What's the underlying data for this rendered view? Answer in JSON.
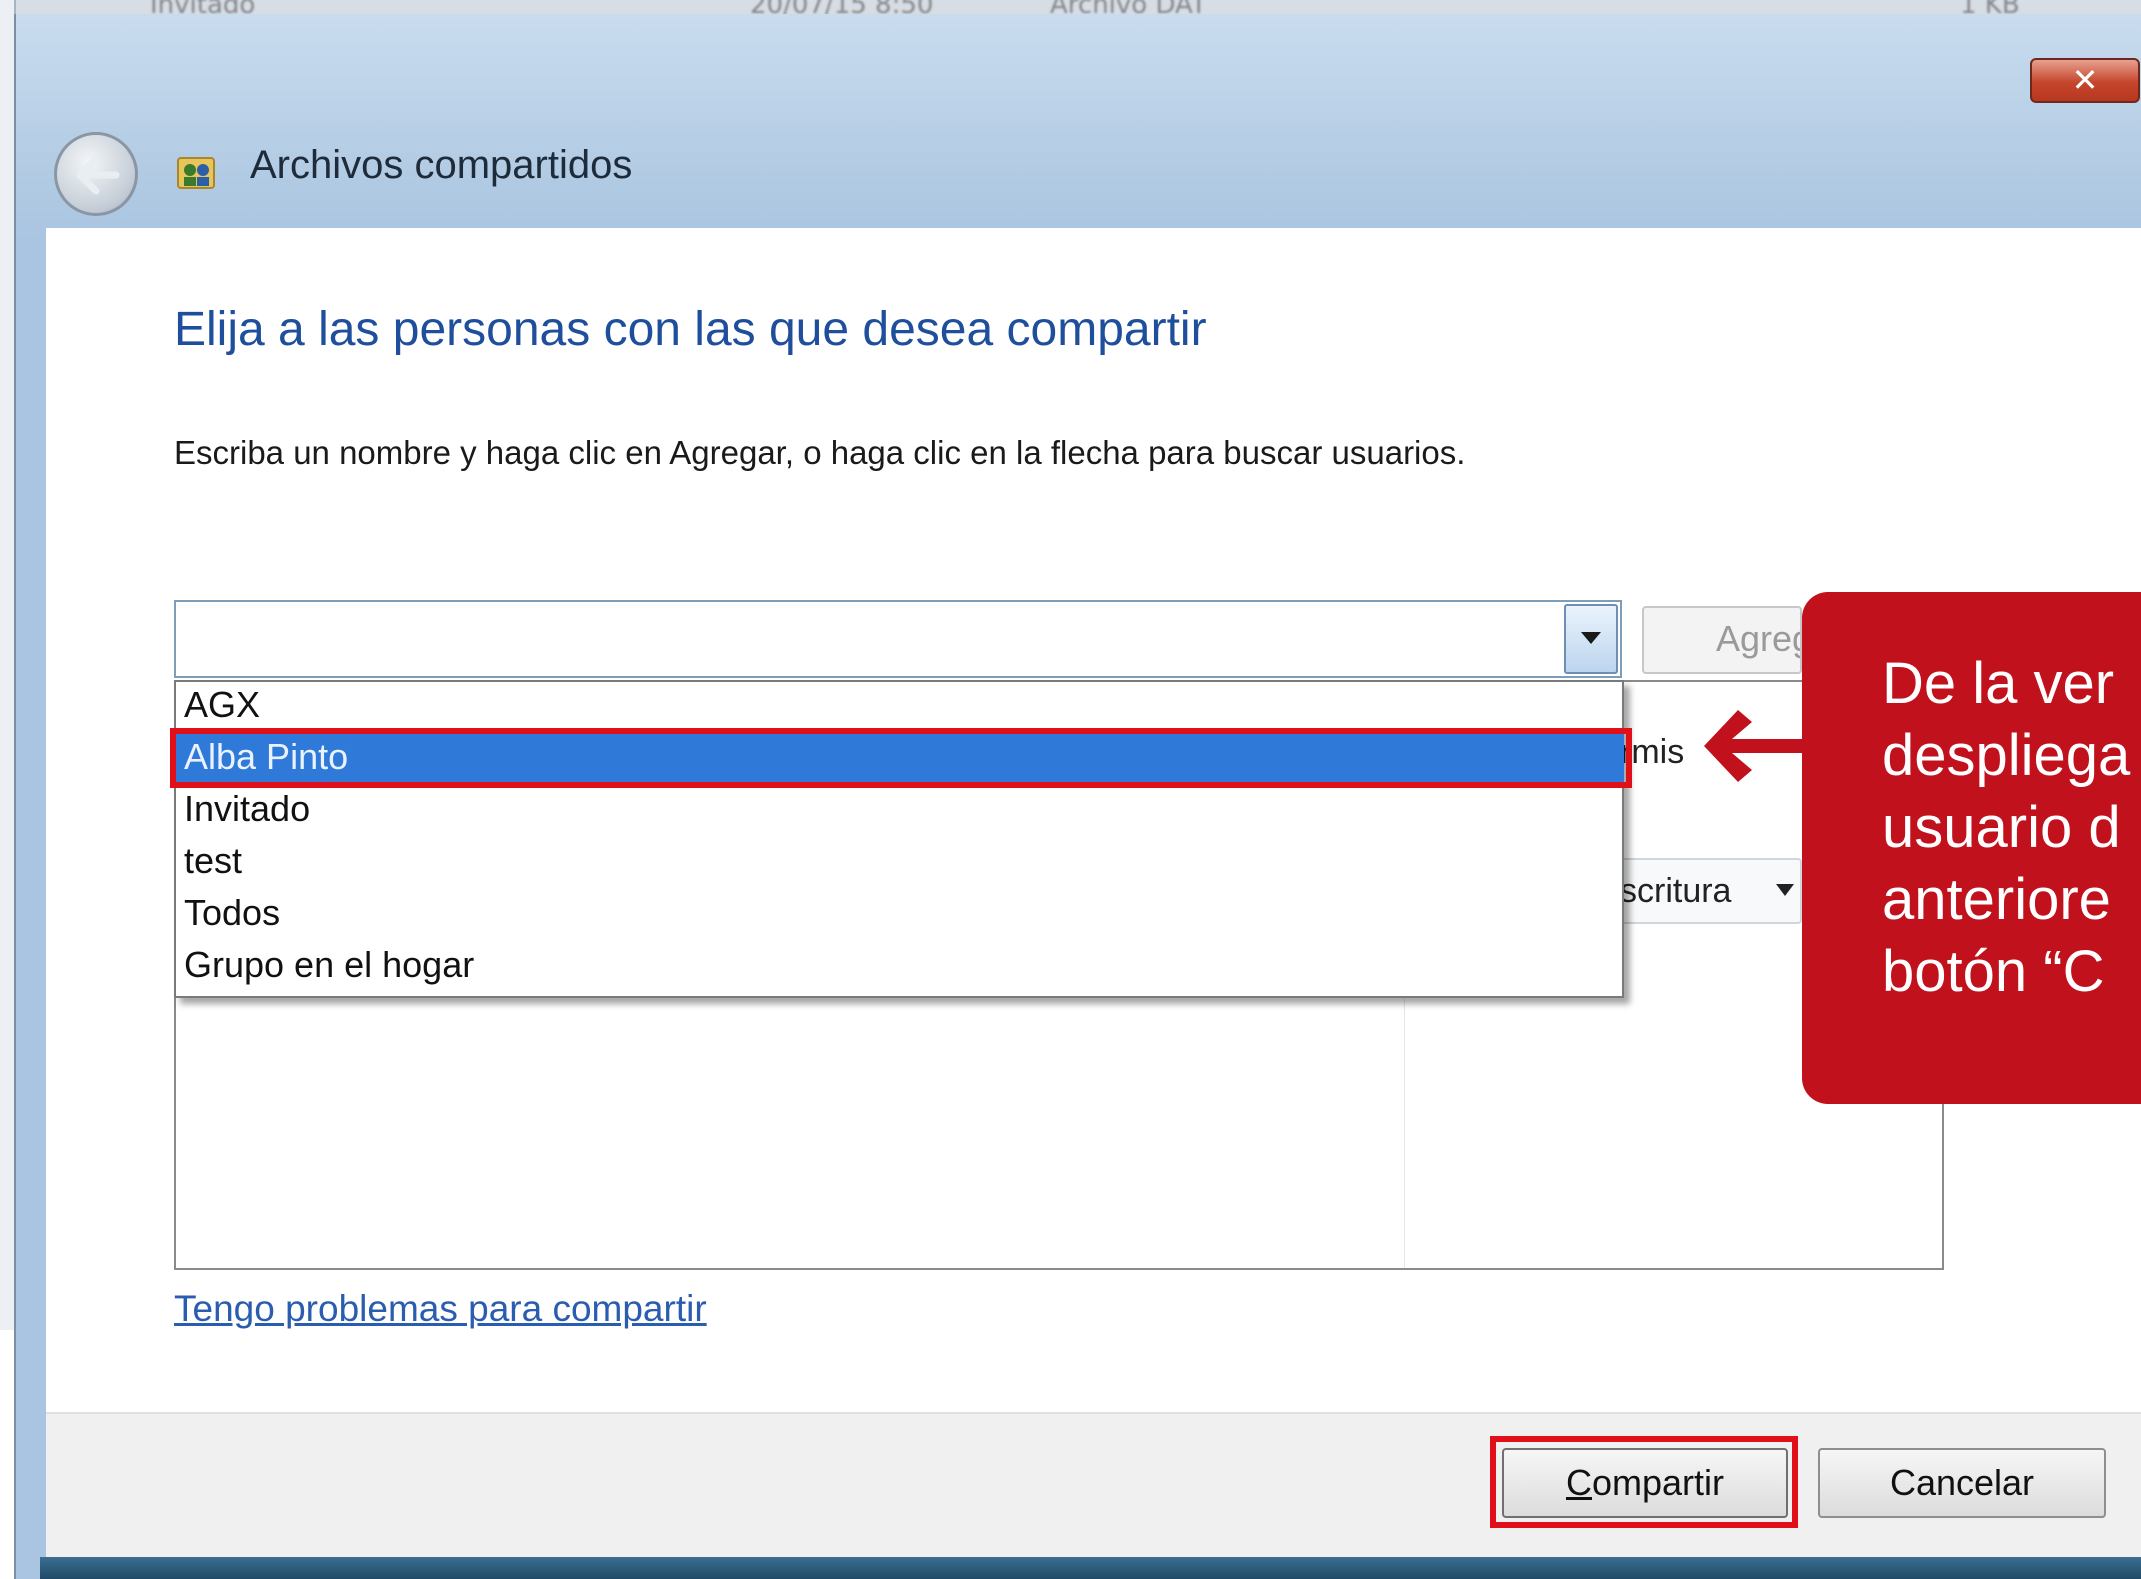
{
  "background_window": {
    "fragments": [
      "Invitado",
      "20/07/15 8:50",
      "Archivo DAT",
      "1 KB"
    ]
  },
  "window": {
    "title": "Archivos compartidos",
    "close_label": "✕"
  },
  "dialog": {
    "heading": "Elija a las personas con las que desea compartir",
    "instruction": "Escriba un nombre y haga clic en Agregar, o haga clic en la flecha para buscar usuarios.",
    "combo_value": "",
    "add_button_label": "Agregar",
    "dropdown_options": [
      "AGX",
      "Alba Pinto",
      "Invitado",
      "test",
      "Todos",
      "Grupo en el hogar"
    ],
    "selected_option": "Alba Pinto",
    "permission_header_fragment": "rmis",
    "permission_level_fragment": "scritura",
    "trouble_link": "Tengo problemas para compartir",
    "share_button": {
      "mnemonic": "C",
      "rest": "ompartir"
    },
    "cancel_button": "Cancelar"
  },
  "callout": {
    "lines": [
      "De la ver",
      "despliega",
      "usuario d",
      "anteriore",
      "botón “C"
    ],
    "color": "#c0111c"
  },
  "colors": {
    "highlight": "#e10f1a",
    "selection": "#2f7ad9",
    "heading": "#1f4f9c",
    "link": "#2a5cb0"
  }
}
